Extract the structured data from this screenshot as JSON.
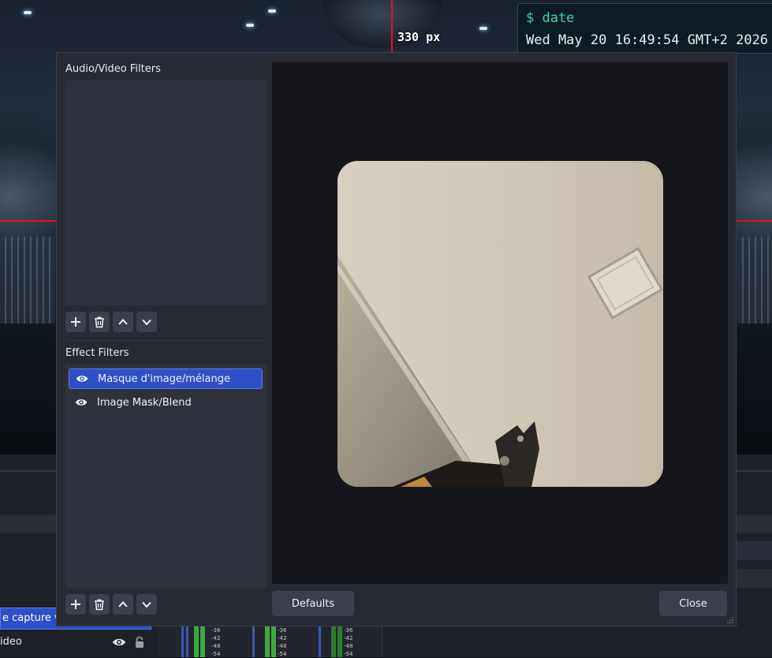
{
  "overlay": {
    "measure_label": "330 px",
    "terminal_prompt": "$ date",
    "terminal_output": "Wed May 20 16:49:54 GMT+2 2026"
  },
  "obs_main": {
    "sources": [
      {
        "label": "e capture vi",
        "selected": true
      },
      {
        "label": "ideo",
        "selected": false
      }
    ],
    "meter_scale": [
      "-36",
      "-42",
      "-48",
      "-54"
    ]
  },
  "dialog": {
    "audio_video_title": "Audio/Video Filters",
    "effect_title": "Effect Filters",
    "effect_filters": [
      {
        "label": "Masque d'image/mélange",
        "visible": true,
        "selected": true
      },
      {
        "label": "Image Mask/Blend",
        "visible": true,
        "selected": false
      }
    ],
    "defaults_label": "Defaults",
    "close_label": "Close"
  },
  "colors": {
    "accent": "#2f4fc8",
    "guide_red": "#e0141e",
    "dialog_bg": "#272a33",
    "preview_bg": "#15171d"
  },
  "icons": {
    "add": "plus-icon",
    "remove": "trash-icon",
    "up": "chevron-up-icon",
    "down": "chevron-down-icon",
    "visibility": "eye-icon",
    "lock": "lock-icon"
  }
}
